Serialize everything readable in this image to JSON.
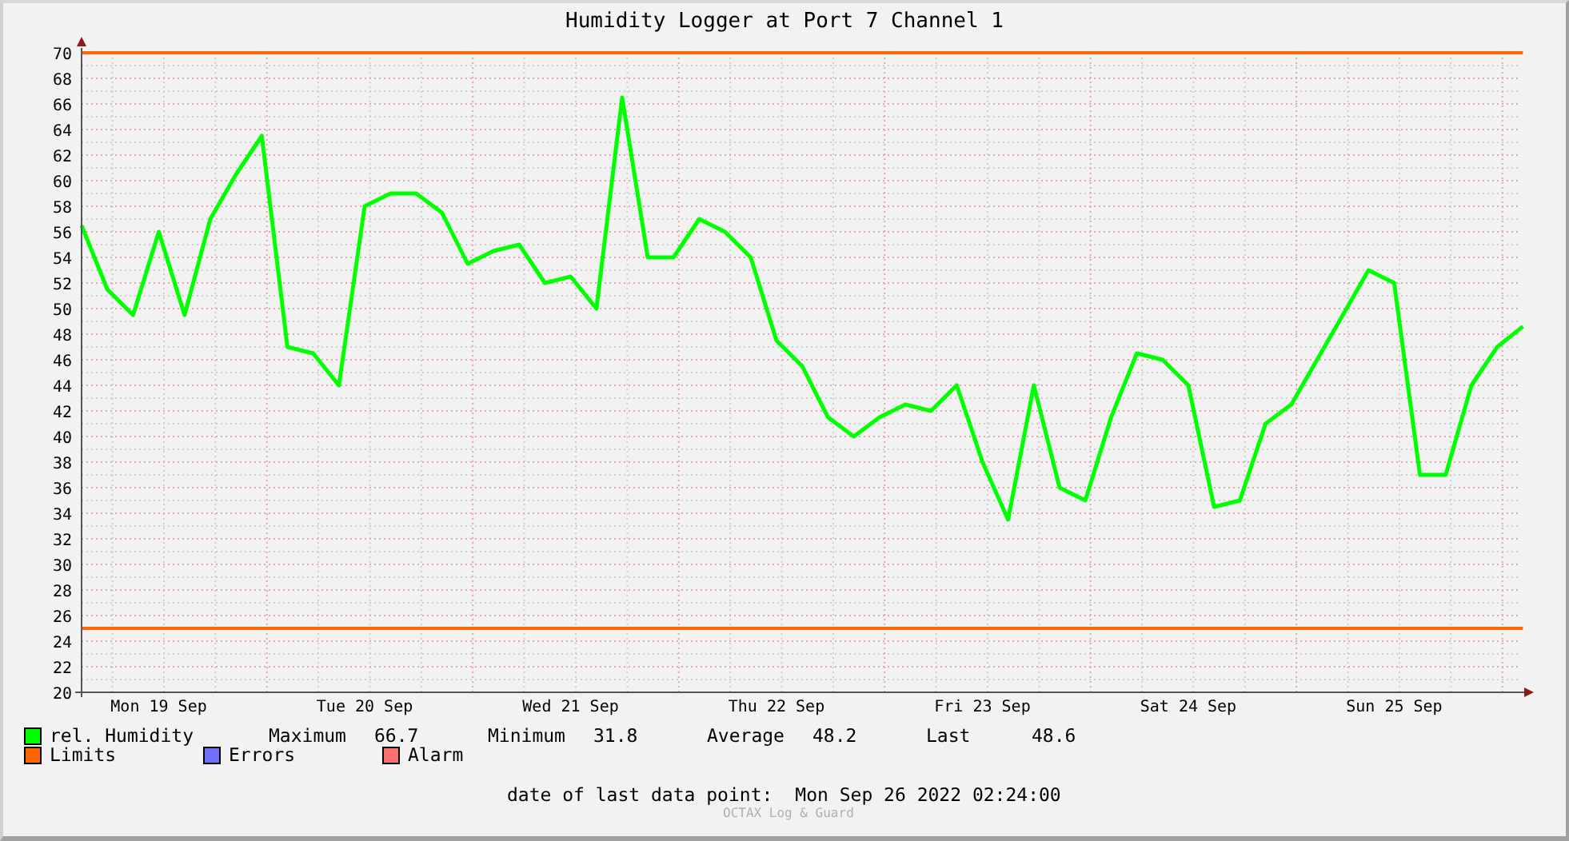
{
  "chart": {
    "chart_data": {
      "type": "line",
      "title": "Humidity Logger at Port 7 Channel 1",
      "categories": [
        null,
        null,
        null,
        "Mon 19 Sep",
        null,
        null,
        null,
        null,
        null,
        null,
        null,
        "Tue 20 Sep",
        null,
        null,
        null,
        null,
        null,
        null,
        null,
        "Wed 21 Sep",
        null,
        null,
        null,
        null,
        null,
        null,
        null,
        "Thu 22 Sep",
        null,
        null,
        null,
        null,
        null,
        null,
        null,
        "Fri 23 Sep",
        null,
        null,
        null,
        null,
        null,
        null,
        null,
        "Sat 24 Sep",
        null,
        null,
        null,
        null,
        null,
        null,
        null,
        "Sun 25 Sep",
        null,
        null,
        null,
        null,
        null
      ],
      "series": [
        {
          "name": "rel. Humidity",
          "color": "#00ff00",
          "values": [
            56.5,
            51.5,
            49.5,
            56,
            49.5,
            57,
            60.5,
            63.5,
            47,
            46.5,
            44,
            58,
            59,
            59,
            57.5,
            53.5,
            54.5,
            55,
            52,
            52.5,
            50,
            66.5,
            54,
            54,
            57,
            56,
            54,
            47.5,
            45.5,
            41.5,
            40,
            41.5,
            42.5,
            42,
            44,
            38,
            33.5,
            44,
            36,
            35,
            41.5,
            46.5,
            46,
            44,
            34.5,
            35,
            41,
            42.5,
            46,
            49.5,
            53,
            52,
            37,
            37,
            44,
            47,
            48.6
          ]
        },
        {
          "name": "Limits",
          "color": "#ff6600",
          "values": [
            70,
            70,
            70,
            70,
            70,
            70,
            70,
            70,
            70,
            70,
            70,
            70,
            70,
            70,
            70,
            70,
            70,
            70,
            70,
            70,
            70,
            70,
            70,
            70,
            70,
            70,
            70,
            70,
            70,
            70,
            70,
            70,
            70,
            70,
            70,
            70,
            70,
            70,
            70,
            70,
            70,
            70,
            70,
            70,
            70,
            70,
            70,
            70,
            70,
            70,
            70,
            70,
            70,
            70,
            70,
            70,
            70
          ]
        },
        {
          "color": "#ff6600",
          "values": [
            25,
            25,
            25,
            25,
            25,
            25,
            25,
            25,
            25,
            25,
            25,
            25,
            25,
            25,
            25,
            25,
            25,
            25,
            25,
            25,
            25,
            25,
            25,
            25,
            25,
            25,
            25,
            25,
            25,
            25,
            25,
            25,
            25,
            25,
            25,
            25,
            25,
            25,
            25,
            25,
            25,
            25,
            25,
            25,
            25,
            25,
            25,
            25,
            25,
            25,
            25,
            25,
            25,
            25,
            25,
            25,
            25
          ]
        }
      ],
      "ylim": [
        20,
        70
      ],
      "yticks": [
        20,
        22,
        24,
        26,
        28,
        30,
        32,
        34,
        36,
        38,
        40,
        42,
        44,
        46,
        48,
        50,
        52,
        54,
        56,
        58,
        60,
        62,
        64,
        66,
        68,
        70
      ],
      "grid": true
    }
  },
  "legend": {
    "items": [
      {
        "label": "Errors",
        "color": "#6f6fff"
      },
      {
        "label": "Alarm",
        "color": "#ff6f6f"
      }
    ],
    "stats": [
      {
        "label": "Maximum",
        "value": "66.7"
      },
      {
        "label": "Minimum",
        "value": "31.8"
      },
      {
        "label": "Average",
        "value": "48.2"
      },
      {
        "label": "Last",
        "value": "48.6"
      }
    ]
  },
  "footer": {
    "label": "date of last data point:",
    "value": "Mon Sep 26 2022 02:24:00",
    "credit": "OCTAX Log & Guard"
  }
}
